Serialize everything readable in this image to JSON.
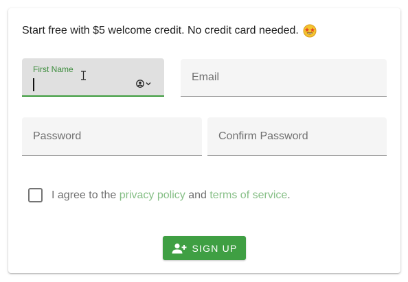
{
  "intro": {
    "text": "Start free with $5 welcome credit. No credit card needed.",
    "emoji_icon": "star-struck-emoji-icon"
  },
  "form": {
    "first_name": {
      "label": "First Name",
      "value": "",
      "autofill_icon": "account-circle-icon"
    },
    "email": {
      "placeholder": "Email"
    },
    "password": {
      "placeholder": "Password"
    },
    "confirm_password": {
      "placeholder": "Confirm Password"
    }
  },
  "agree": {
    "checked": false,
    "prefix": "I agree to the ",
    "privacy_link": "privacy policy",
    "middle": " and ",
    "terms_link": "terms of service",
    "suffix": "."
  },
  "signup_button": {
    "label": "Sign up",
    "icon": "person-add-icon"
  },
  "colors": {
    "accent": "#3f9f43",
    "link": "#86bf86",
    "field_bg": "#f5f5f5",
    "active_field_bg": "#e0e0e0"
  }
}
